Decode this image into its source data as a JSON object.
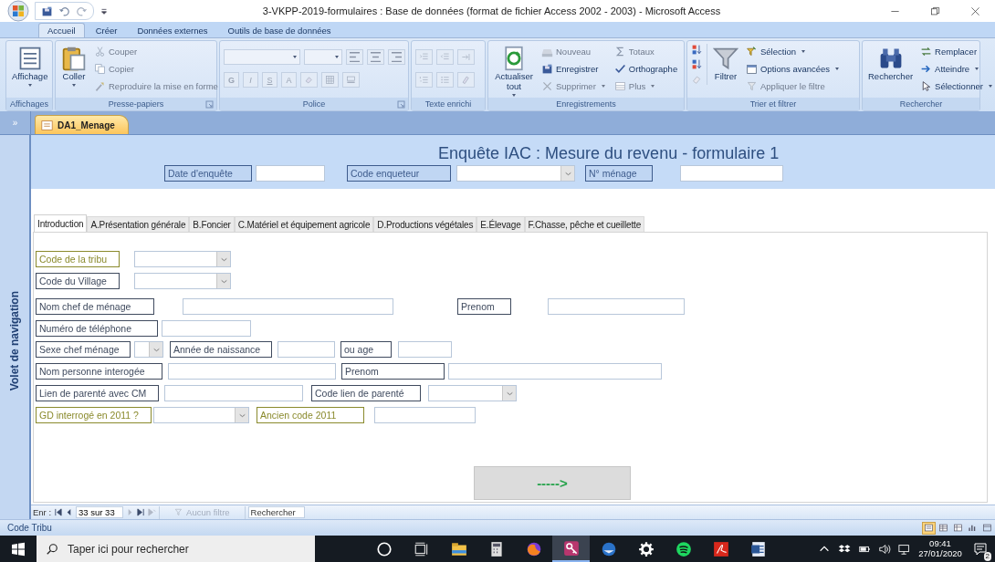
{
  "window": {
    "title": "3-VKPP-2019-formulaires : Base de données (format de fichier Access 2002 - 2003) - Microsoft Access"
  },
  "ribbon": {
    "tabs": [
      {
        "label": "Accueil",
        "selected": true
      },
      {
        "label": "Créer",
        "selected": false
      },
      {
        "label": "Données externes",
        "selected": false
      },
      {
        "label": "Outils de base de données",
        "selected": false
      }
    ],
    "groups": [
      {
        "label": "Affichages",
        "launcher": false,
        "items": [
          {
            "kind": "large",
            "label": "Affichage",
            "disabled": false,
            "dropdown": true
          }
        ]
      },
      {
        "label": "Presse-papiers",
        "launcher": true,
        "items": [
          {
            "kind": "large",
            "label": "Coller",
            "disabled": false,
            "dropdown": true
          },
          {
            "kind": "small",
            "label": "Couper",
            "disabled": true,
            "dropdown": false
          },
          {
            "kind": "small",
            "label": "Copier",
            "disabled": true,
            "dropdown": false
          },
          {
            "kind": "small",
            "label": "Reproduire la mise en forme",
            "disabled": true,
            "dropdown": false
          }
        ]
      },
      {
        "label": "Police",
        "launcher": true,
        "items": [
          {
            "kind": "font-controls",
            "buttons": [
              "G",
              "I",
              "S",
              "A"
            ]
          }
        ]
      },
      {
        "label": "Texte enrichi",
        "launcher": false,
        "items": [
          {
            "kind": "paragraph-controls"
          }
        ]
      },
      {
        "label": "Enregistrements",
        "launcher": false,
        "items": [
          {
            "kind": "large",
            "label": "Actualiser tout",
            "disabled": false,
            "dropdown": true
          },
          {
            "kind": "small",
            "label": "Nouveau",
            "disabled": true,
            "dropdown": false
          },
          {
            "kind": "small",
            "label": "Enregistrer",
            "disabled": false,
            "dropdown": false
          },
          {
            "kind": "small",
            "label": "Supprimer",
            "disabled": true,
            "dropdown": true
          },
          {
            "kind": "small",
            "label": "Totaux",
            "disabled": true,
            "dropdown": false
          },
          {
            "kind": "small",
            "label": "Orthographe",
            "disabled": false,
            "dropdown": false
          },
          {
            "kind": "small",
            "label": "Plus",
            "disabled": true,
            "dropdown": true
          }
        ]
      },
      {
        "label": "Trier et filtrer",
        "launcher": false,
        "items": [
          {
            "kind": "sort-controls"
          },
          {
            "kind": "large",
            "label": "Filtrer",
            "disabled": false,
            "dropdown": false
          },
          {
            "kind": "small",
            "label": "Sélection",
            "disabled": false,
            "dropdown": true
          },
          {
            "kind": "small",
            "label": "Options avancées",
            "disabled": false,
            "dropdown": true
          },
          {
            "kind": "small",
            "label": "Appliquer le filtre",
            "disabled": true,
            "dropdown": false
          }
        ]
      },
      {
        "label": "Rechercher",
        "launcher": false,
        "items": [
          {
            "kind": "large",
            "label": "Rechercher",
            "disabled": false,
            "dropdown": false
          },
          {
            "kind": "small",
            "label": "Remplacer",
            "disabled": false,
            "dropdown": false
          },
          {
            "kind": "small",
            "label": "Atteindre",
            "disabled": false,
            "dropdown": true
          },
          {
            "kind": "small",
            "label": "Sélectionner",
            "disabled": false,
            "dropdown": true
          }
        ]
      }
    ]
  },
  "doc_bar": {
    "toggle": "»",
    "tabs": [
      {
        "label": "DA1_Menage",
        "selected": true
      }
    ]
  },
  "nav_pane": {
    "label": "Volet de navigation"
  },
  "form": {
    "title": "Enquête IAC : Mesure du revenu - formulaire 1",
    "header_fields": [
      {
        "kind": "label",
        "text": "Date d'enquête",
        "color": "#3d5b8c"
      },
      {
        "kind": "text"
      },
      {
        "kind": "label",
        "text": "Code enqueteur",
        "color": "#3d5b8c"
      },
      {
        "kind": "combo"
      },
      {
        "kind": "label",
        "text": "N° ménage",
        "color": "#3d5b8c"
      },
      {
        "kind": "text"
      }
    ],
    "tabs": [
      {
        "label": "Introduction",
        "selected": true
      },
      {
        "label": "A.Présentation générale",
        "selected": false
      },
      {
        "label": "B.Foncier",
        "selected": false
      },
      {
        "label": "C.Matériel et équipement agricole",
        "selected": false
      },
      {
        "label": "D.Productions végétales",
        "selected": false
      },
      {
        "label": "E.Élevage",
        "selected": false
      },
      {
        "label": "F.Chasse, pêche et cueillette",
        "selected": false
      }
    ],
    "rows": [
      [
        {
          "kind": "label",
          "text": "Code de la tribu",
          "color": "#8a8a2c"
        },
        {
          "kind": "combo"
        }
      ],
      [
        {
          "kind": "label",
          "text": "Code du Village",
          "color": "#3f4a5e"
        },
        {
          "kind": "combo"
        }
      ],
      [
        {
          "kind": "label",
          "text": "Nom chef de ménage",
          "color": "#3f4a5e"
        },
        {
          "kind": "text"
        },
        {
          "kind": "label",
          "text": "Prenom",
          "color": "#3f4a5e"
        },
        {
          "kind": "text"
        }
      ],
      [
        {
          "kind": "label",
          "text": "Numéro de téléphone",
          "color": "#3f4a5e"
        },
        {
          "kind": "text"
        }
      ],
      [
        {
          "kind": "label",
          "text": "Sexe chef ménage",
          "color": "#3f4a5e"
        },
        {
          "kind": "combo"
        },
        {
          "kind": "label",
          "text": "Année de naissance",
          "color": "#3f4a5e"
        },
        {
          "kind": "text"
        },
        {
          "kind": "label",
          "text": "ou age",
          "color": "#3f4a5e"
        },
        {
          "kind": "text"
        }
      ],
      [
        {
          "kind": "label",
          "text": "Nom personne interogée",
          "color": "#3f4a5e"
        },
        {
          "kind": "text"
        },
        {
          "kind": "label",
          "text": "Prenom",
          "color": "#3f4a5e"
        },
        {
          "kind": "text"
        }
      ],
      [
        {
          "kind": "label",
          "text": "Lien de parenté avec CM",
          "color": "#3f4a5e"
        },
        {
          "kind": "text"
        },
        {
          "kind": "label",
          "text": "Code lien de parenté",
          "color": "#3f4a5e"
        },
        {
          "kind": "combo"
        }
      ],
      [
        {
          "kind": "label",
          "text": "GD interrogé en 2011 ?",
          "color": "#8a8a2c"
        },
        {
          "kind": "combo"
        },
        {
          "kind": "label",
          "text": "Ancien code 2011",
          "color": "#8a8a2c"
        },
        {
          "kind": "text"
        }
      ]
    ],
    "next_button": "----->"
  },
  "record_nav": {
    "prefix": "Enr :",
    "position": "33 sur 33",
    "filter": {
      "label": "Aucun filtre",
      "disabled": true
    },
    "search": {
      "placeholder": "Rechercher"
    }
  },
  "status_bar": {
    "text": "Code Tribu",
    "view_buttons": [
      {
        "selected": true
      },
      {
        "selected": false
      },
      {
        "selected": false
      },
      {
        "selected": false
      },
      {
        "selected": false
      }
    ]
  },
  "taskbar": {
    "search": {
      "placeholder": "Taper ici pour rechercher"
    },
    "apps": [
      {
        "selected": false
      },
      {
        "selected": false
      },
      {
        "selected": false
      },
      {
        "selected": false
      },
      {
        "selected": false
      },
      {
        "selected": true
      },
      {
        "selected": false
      },
      {
        "selected": false
      },
      {
        "selected": false
      },
      {
        "selected": false
      },
      {
        "selected": false
      }
    ],
    "time": "09:41",
    "date": "27/01/2020",
    "notifications": "2"
  }
}
